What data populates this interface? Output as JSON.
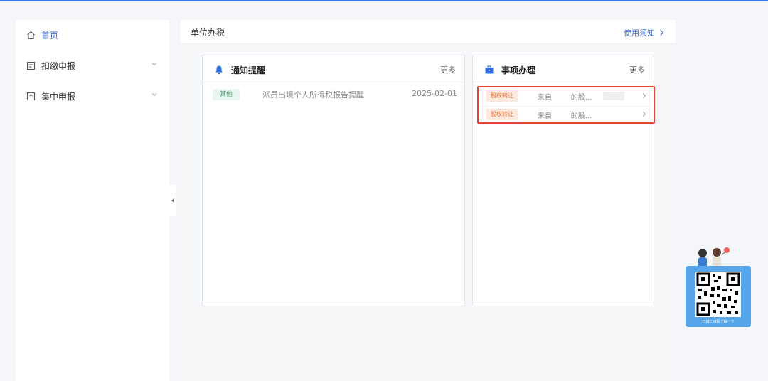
{
  "sidebar": {
    "items": [
      {
        "label": "首页",
        "icon": "home-icon",
        "active": true
      },
      {
        "label": "扣缴申报",
        "icon": "report-icon",
        "expandable": true
      },
      {
        "label": "集中申报",
        "icon": "upload-icon",
        "expandable": true
      }
    ]
  },
  "main": {
    "title": "单位办税",
    "help_link": "使用须知"
  },
  "notice": {
    "title": "通知提醒",
    "more": "更多",
    "items": [
      {
        "tag": "其他",
        "text": "派员出境个人所得税报告提醒",
        "date": "2025-02-01"
      }
    ]
  },
  "affairs": {
    "title": "事项办理",
    "more": "更多",
    "items": [
      {
        "tag": "股权转让",
        "from_label": "来自",
        "from_value": "'的股..."
      },
      {
        "tag": "股权转让",
        "from_label": "来自",
        "from_value": "'的股..."
      }
    ]
  },
  "qr": {
    "caption": "扫描二维码了解一下"
  },
  "colors": {
    "accent": "#3f6fd8",
    "highlight": "#e0462e",
    "tag_other_bg": "#e8f6ef",
    "tag_equity_bg": "#fde9de",
    "qr_bg": "#55a6ea"
  }
}
